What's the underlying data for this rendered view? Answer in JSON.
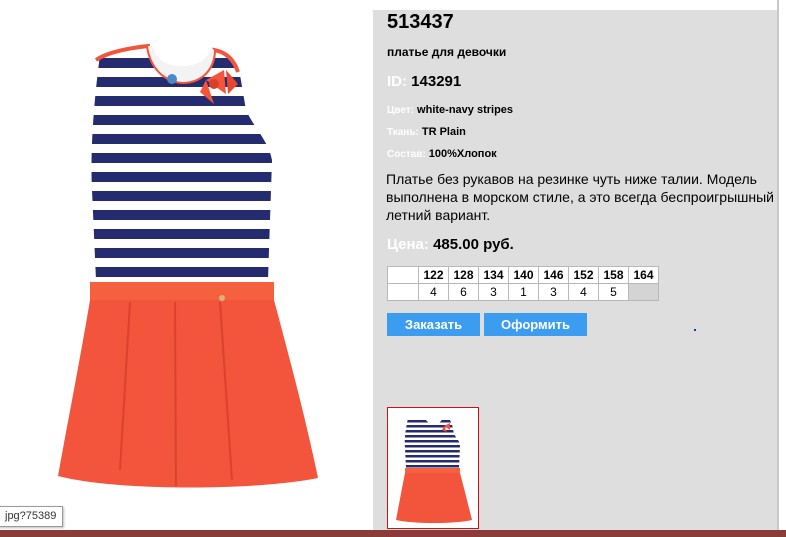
{
  "product": {
    "article": "513437",
    "subtitle": "платье для девочки",
    "id_label": "ID:",
    "id_value": "143291",
    "color_label": "Цвет:",
    "color_value": "white-navy stripes",
    "fabric_label": "Ткань:",
    "fabric_value": "TR Plain",
    "composition_label": "Состав:",
    "composition_value": "100%Хлопок",
    "description": "Платье без рукавов на резинке чуть ниже талии. Модель выполнена в морском стиле, а это всегда беспроигрышный летний вариант.",
    "price_label": "Цена:",
    "price_value": "485.00 руб."
  },
  "sizes": {
    "headers": [
      "122",
      "128",
      "134",
      "140",
      "146",
      "152",
      "158",
      "164"
    ],
    "quantities": [
      "4",
      "6",
      "3",
      "1",
      "3",
      "4",
      "5",
      ""
    ]
  },
  "buttons": {
    "order": "Заказать",
    "checkout": "Оформить"
  },
  "image_tooltip": "jpg?75389",
  "colors": {
    "panel_bg": "#dedede",
    "button_blue": "#3c9cf0",
    "dress_navy": "#242b6e",
    "dress_coral": "#f2543c",
    "thumb_border": "#d01010"
  },
  "icons": {
    "main_image": "dress-photo",
    "thumbnail": "dress-thumbnail"
  }
}
